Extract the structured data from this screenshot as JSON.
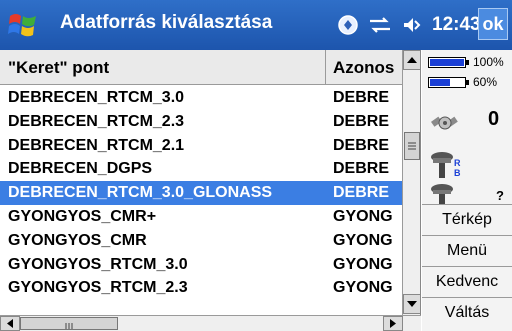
{
  "titlebar": {
    "title": "Adatforrás kiválasztása",
    "time": "12:43",
    "ok_label": "ok"
  },
  "list": {
    "columns": [
      "\"Keret\" pont",
      "Azonos"
    ],
    "rows": [
      {
        "name": "DEBRECEN_RTCM_3.0",
        "id": "DEBRE"
      },
      {
        "name": "DEBRECEN_RTCM_2.3",
        "id": "DEBRE"
      },
      {
        "name": "DEBRECEN_RTCM_2.1",
        "id": "DEBRE"
      },
      {
        "name": "DEBRECEN_DGPS",
        "id": "DEBRE"
      },
      {
        "name": "DEBRECEN_RTCM_3.0_GLONASS",
        "id": "DEBRE"
      },
      {
        "name": "GYONGYOS_CMR+",
        "id": "GYONG"
      },
      {
        "name": "GYONGYOS_CMR",
        "id": "GYONG"
      },
      {
        "name": "GYONGYOS_RTCM_3.0",
        "id": "GYONG"
      },
      {
        "name": "GYONGYOS_RTCM_2.3",
        "id": "GYONG"
      }
    ],
    "selected_index": 4
  },
  "status": {
    "battery1": "100%",
    "battery2": "60%",
    "battery1_level": 1.0,
    "battery2_level": 0.6,
    "satellites": "0",
    "antenna_label": "?",
    "antenna_badge": "R\nB"
  },
  "menu": {
    "items": [
      "Térkép",
      "Menü",
      "Kedvenc",
      "Váltás"
    ]
  },
  "colors": {
    "titlebar": "#1d55ad",
    "selection": "#3b7ee3"
  }
}
